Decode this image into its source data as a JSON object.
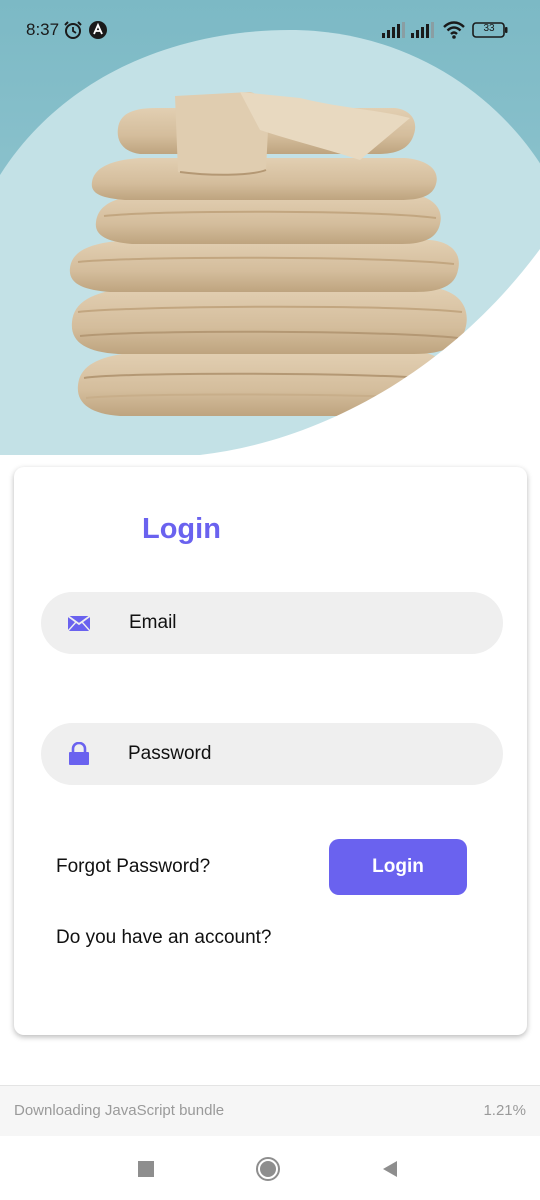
{
  "status_bar": {
    "time": "8:37",
    "battery_level": "33",
    "icons": [
      "alarm-icon",
      "app-notification-icon",
      "signal-icon",
      "signal-icon",
      "wifi-icon",
      "battery-icon"
    ]
  },
  "hero": {
    "image": "folded-bedding-stack"
  },
  "login": {
    "title": "Login",
    "email_placeholder": "Email",
    "password_placeholder": "Password",
    "forgot_password": "Forgot Password?",
    "login_button": "Login",
    "account_prompt": "Do you have an account?"
  },
  "bundle": {
    "text": "Downloading JavaScript bundle",
    "percent": "1.21%"
  },
  "navigation": {
    "buttons": [
      "recents-icon",
      "home-icon",
      "back-icon"
    ]
  },
  "colors": {
    "accent": "#6a62ef",
    "field_background": "#efefef",
    "hero_background": "#7fbcc7"
  }
}
